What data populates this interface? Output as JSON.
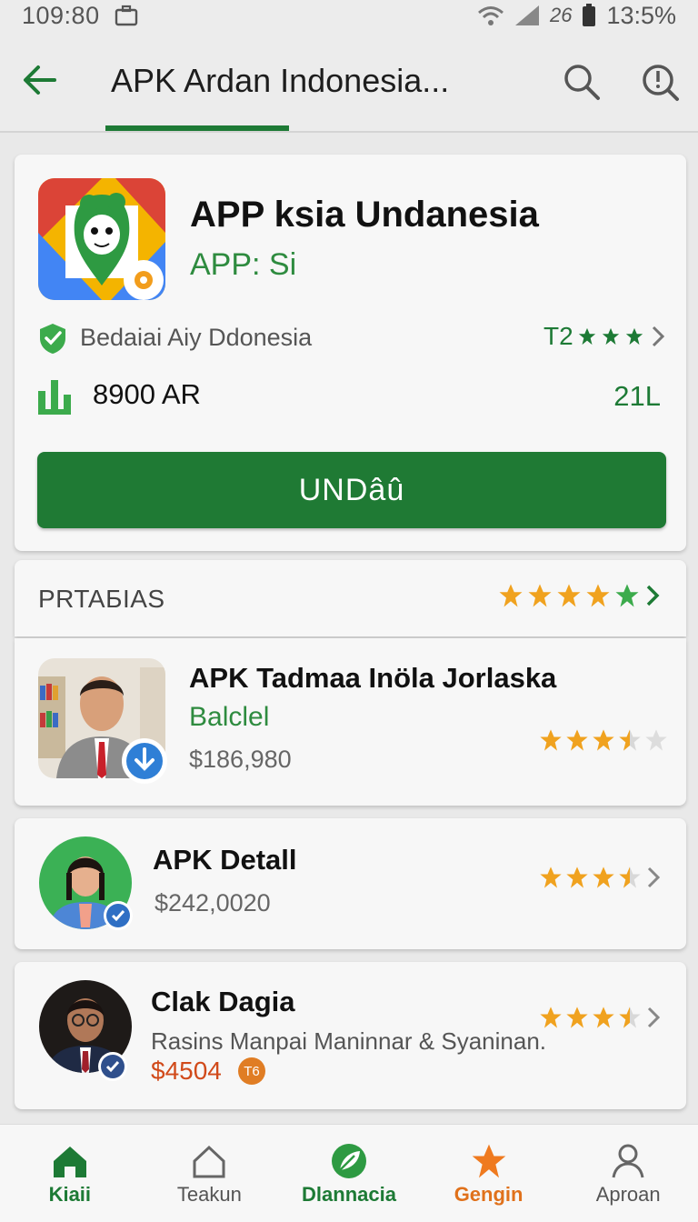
{
  "status_bar": {
    "time": "109:80",
    "battery": "13:5%",
    "network": "26"
  },
  "app_bar": {
    "title": "APK Ardan Indonesia..."
  },
  "hero": {
    "app_name": "APP ksia Undanesia",
    "app_sub": "APP: Si",
    "developer": "Bedaiai Aiy Ddonesia",
    "rating_text": "T2",
    "downloads": "8900 AR",
    "size": "21L",
    "install_label": "UNDâû"
  },
  "ratings_section": {
    "label": "PRTAБIAS",
    "stars": 5
  },
  "items": [
    {
      "title": "APK Tadmaa Inöla Jorlaska",
      "subtitle": "Balclel",
      "price": "$186,980",
      "rating": 3.5
    },
    {
      "title": "APK Detall",
      "price": "$242,0020",
      "rating": 3.5
    },
    {
      "title": "Clak Dagia",
      "description": "Rasins Manpai Maninnar & Syaninan.",
      "price": "$4504",
      "price_badge": "T6",
      "rating": 3.5
    }
  ],
  "bottom_nav": [
    {
      "label": "Kiaii",
      "icon": "home-icon",
      "state": "active"
    },
    {
      "label": "Teakun",
      "icon": "home-outline-icon",
      "state": "normal"
    },
    {
      "label": "Dlannacia",
      "icon": "leaf-icon",
      "state": "active"
    },
    {
      "label": "Gengin",
      "icon": "star-icon",
      "state": "highlight"
    },
    {
      "label": "Aproan",
      "icon": "person-icon",
      "state": "normal"
    }
  ],
  "colors": {
    "accent_green": "#1f7a34",
    "star_orange": "#f0a21f",
    "price_red": "#d14a1a"
  }
}
